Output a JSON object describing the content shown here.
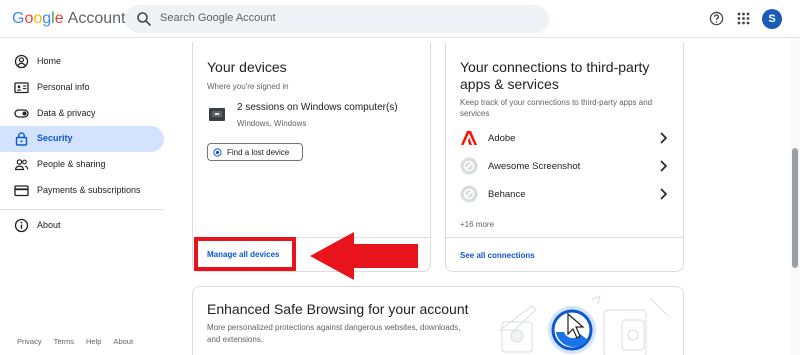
{
  "header": {
    "logo_letters": [
      "G",
      "o",
      "o",
      "g",
      "l",
      "e"
    ],
    "logo_suffix": "Account",
    "search_placeholder": "Search Google Account",
    "avatar_initial": "S",
    "icons": [
      "search-icon",
      "help-icon",
      "apps-grid-icon"
    ]
  },
  "sidebar": {
    "items": [
      {
        "label": "Home",
        "icon": "home-icon"
      },
      {
        "label": "Personal info",
        "icon": "id-card-icon"
      },
      {
        "label": "Data & privacy",
        "icon": "toggle-icon"
      },
      {
        "label": "Security",
        "icon": "lock-icon",
        "active": true
      },
      {
        "label": "People & sharing",
        "icon": "people-icon"
      },
      {
        "label": "Payments & subscriptions",
        "icon": "credit-card-icon"
      },
      {
        "label": "About",
        "icon": "info-icon"
      }
    ],
    "footer": [
      "Privacy",
      "Terms",
      "Help",
      "About"
    ]
  },
  "devices_card": {
    "title": "Your devices",
    "subtitle": "Where you're signed in",
    "session_title": "2 sessions on Windows computer(s)",
    "session_sub": "Windows, Windows",
    "find_button": "Find a lost device",
    "manage_link": "Manage all devices"
  },
  "connections_card": {
    "title_line1": "Your connections to third-party",
    "title_line2": "apps & services",
    "desc_line1": "Keep track of your connections to third-party apps and",
    "desc_line2": "services",
    "items": [
      {
        "label": "Adobe",
        "icon": "adobe-icon"
      },
      {
        "label": "Awesome Screenshot",
        "icon": "app-placeholder-icon"
      },
      {
        "label": "Behance",
        "icon": "app-placeholder-icon"
      }
    ],
    "more": "+16 more",
    "see_all": "See all connections"
  },
  "safe_browsing": {
    "title": "Enhanced Safe Browsing for your account",
    "desc_line1": "More personalized protections against dangerous websites, downloads,",
    "desc_line2": "and extensions."
  },
  "colors": {
    "accent_blue": "#0b57d0",
    "active_nav_bg": "#d3e3fd",
    "annotation_red": "#e8141c",
    "avatar_bg": "#1a5bb8"
  }
}
